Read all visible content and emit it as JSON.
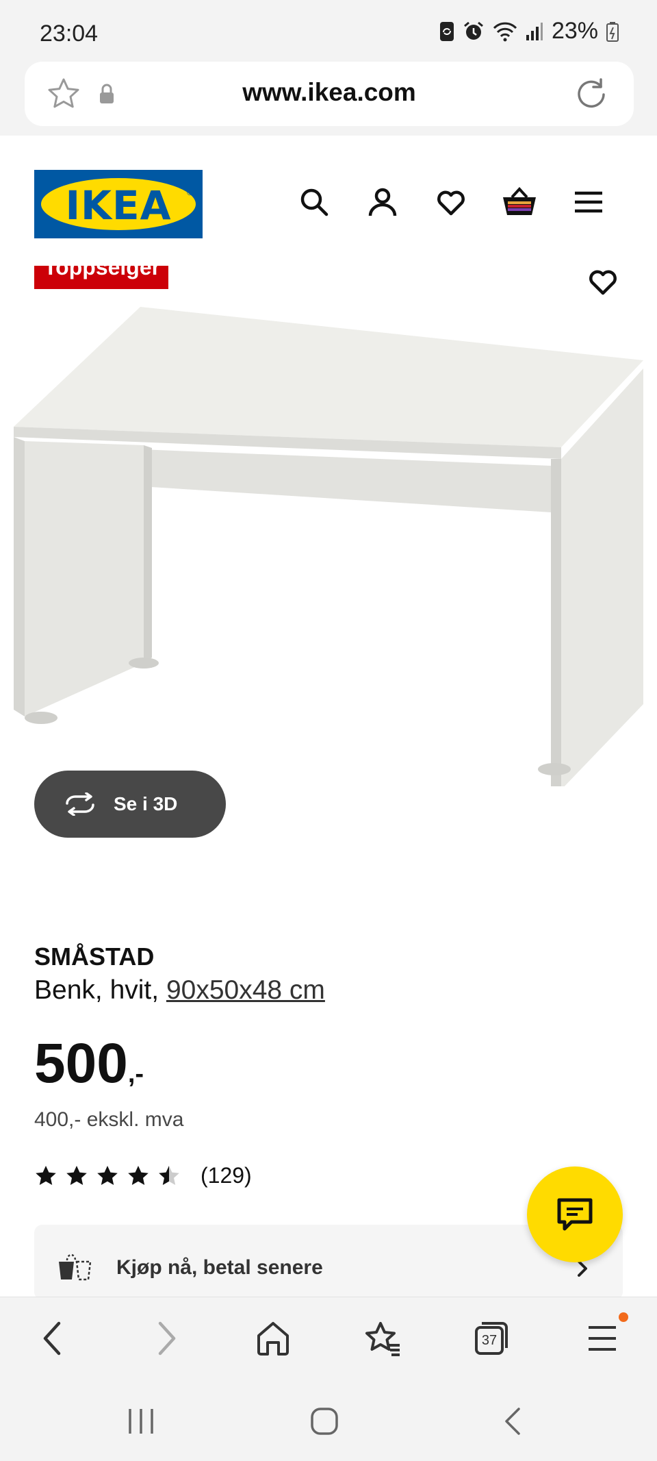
{
  "status_bar": {
    "time": "23:04",
    "battery": "23%"
  },
  "browser": {
    "url": "www.ikea.com",
    "tab_count": "37"
  },
  "header": {
    "logo_text": "IKEA"
  },
  "product": {
    "badge": "Toppselger",
    "see_3d_label": "Se i 3D",
    "name": "SMÅSTAD",
    "description": "Benk, hvit, ",
    "dimensions": "90x50x48 cm",
    "price": "500",
    "price_suffix": ",-",
    "price_ex_vat": "400,- ekskl. mva",
    "rating": {
      "value": 4.5,
      "max": 5,
      "count": "(129)"
    },
    "bnpl_label": "Kjøp nå, betal senere"
  },
  "colors": {
    "ikea_blue": "#0058a3",
    "ikea_yellow": "#ffdb00",
    "badge_red": "#cc0008",
    "notification_dot": "#f26a1b"
  },
  "icons": {
    "url_bar": [
      "star-icon",
      "lock-icon",
      "reload-icon"
    ],
    "header": [
      "search-icon",
      "profile-icon",
      "heart-icon",
      "cart-icon",
      "menu-icon"
    ],
    "browser_nav": [
      "back-icon",
      "forward-icon",
      "home-icon",
      "bookmarks-icon",
      "tabs-icon",
      "menu-icon"
    ],
    "system_nav": [
      "recents-icon",
      "home-icon",
      "back-icon"
    ]
  }
}
